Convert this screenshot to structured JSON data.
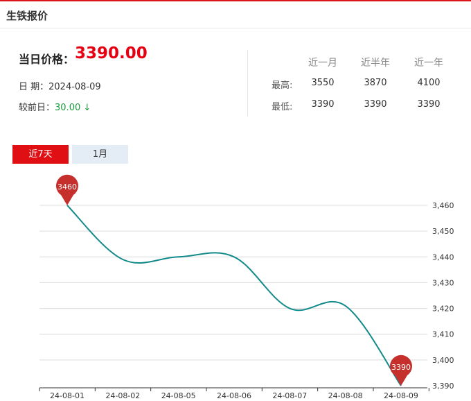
{
  "header": {
    "title": "生铁报价"
  },
  "price": {
    "label": "当日价格：",
    "value": "3390.00",
    "date_label": "日 期：",
    "date_value": "2024-08-09",
    "change_label": "较前日：",
    "change_value": "30.00",
    "change_arrow": "↓"
  },
  "stats": {
    "headers": [
      "近一月",
      "近半年",
      "近一年"
    ],
    "rows": [
      {
        "label": "最高:",
        "values": [
          "3550",
          "3870",
          "4100"
        ]
      },
      {
        "label": "最低:",
        "values": [
          "3390",
          "3390",
          "3390"
        ]
      }
    ]
  },
  "tabs": [
    {
      "label": "近7天",
      "active": true
    },
    {
      "label": "1月",
      "active": false
    }
  ],
  "colors": {
    "accent": "#e00f14",
    "line": "#138a8a",
    "pin": "#c5302d",
    "down": "#1a9a3c"
  },
  "chart_data": {
    "type": "line",
    "x": [
      "24-08-01",
      "24-08-02",
      "24-08-05",
      "24-08-06",
      "24-08-07",
      "24-08-08",
      "24-08-09"
    ],
    "series": [
      {
        "values": [
          3460,
          3439,
          3440,
          3440,
          3420,
          3421,
          3390
        ]
      }
    ],
    "ylim": [
      3390,
      3460
    ],
    "yticks": [
      3390,
      3400,
      3410,
      3420,
      3430,
      3440,
      3450,
      3460
    ],
    "ytick_labels": [
      "3,390",
      "3,400",
      "3,410",
      "3,420",
      "3,430",
      "3,440",
      "3,450",
      "3,460"
    ],
    "grid": true,
    "y_axis_side": "right",
    "annotations": [
      {
        "x": "24-08-01",
        "value": 3460,
        "label": "3460",
        "type": "max-pin"
      },
      {
        "x": "24-08-09",
        "value": 3390,
        "label": "3390",
        "type": "min-pin"
      }
    ]
  }
}
